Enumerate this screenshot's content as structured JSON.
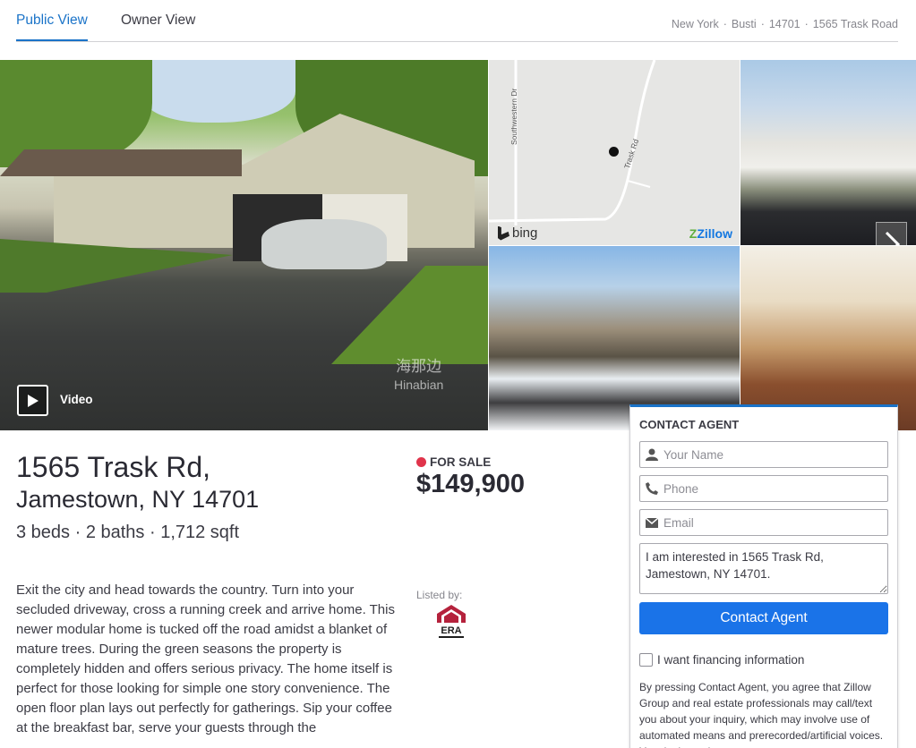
{
  "tabs": [
    {
      "label": "Public View",
      "active": true
    },
    {
      "label": "Owner View",
      "active": false
    }
  ],
  "breadcrumbs": [
    "New York",
    "Busti",
    "14701",
    "1565 Trask Road"
  ],
  "gallery": {
    "video_label": "Video",
    "watermark_cn": "海那边",
    "watermark_en": "Hinabian",
    "map": {
      "road_label_1": "Southwestern Dr",
      "road_label_2": "Trask Rd",
      "provider": "bing",
      "brand": "Zillow"
    }
  },
  "listing": {
    "address_line1": "1565 Trask Rd,",
    "address_line2": "Jamestown, NY 14701",
    "facts": "3 beds · 2 baths · 1,712 sqft",
    "status": "FOR SALE",
    "status_color": "#e0344b",
    "price": "$149,900",
    "listed_by_label": "Listed by:",
    "broker_logo": "ERA",
    "description": "Exit the city and head towards the country. Turn into your secluded driveway, cross a running creek and arrive home. This newer modular home is tucked off the road amidst a blanket of mature trees. During the green seasons the property is completely hidden and offers serious privacy. The home itself is perfect for those looking for simple one story convenience. The open floor plan lays out perfectly for gatherings. Sip your coffee at the breakfast bar, serve your guests through the"
  },
  "contact": {
    "title": "CONTACT AGENT",
    "name_placeholder": "Your Name",
    "phone_placeholder": "Phone",
    "email_placeholder": "Email",
    "message": "I am interested in 1565 Trask Rd, Jamestown, NY 14701.",
    "button_label": "Contact Agent",
    "financing_label": "I want financing information",
    "disclaimer": "By pressing Contact Agent, you agree that Zillow Group and real estate professionals may call/text you about your inquiry, which may involve use of automated means and prerecorded/artificial voices. You don't need"
  },
  "colors": {
    "accent": "#1a73c8",
    "cta": "#1a73e8",
    "text": "#2a2a33"
  }
}
